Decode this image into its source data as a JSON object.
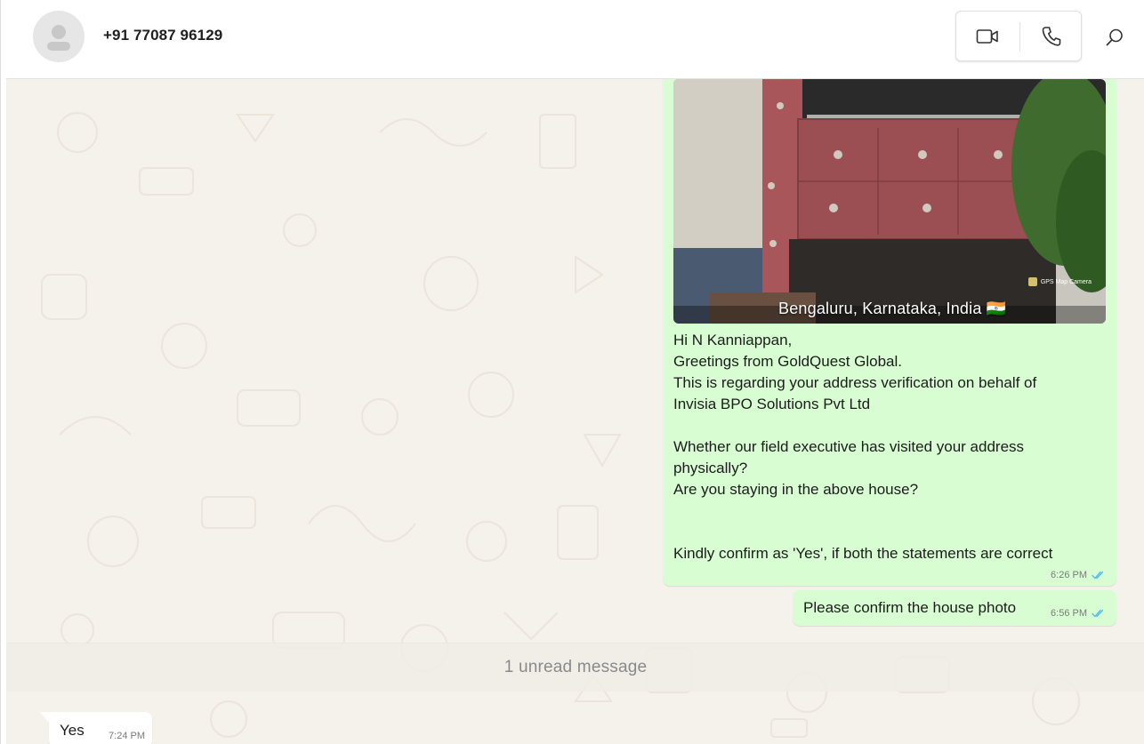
{
  "header": {
    "contact_name": "+91 77087 96129"
  },
  "icons": {
    "avatar": "person-placeholder-icon",
    "video": "video-camera-icon",
    "voice": "phone-icon",
    "search": "search-icon",
    "read": "double-check-icon"
  },
  "colors": {
    "outgoing_bubble": "#d8fdd2",
    "incoming_bubble": "#ffffff",
    "chat_background": "#f5f1eb",
    "read_ticks": "#53bdeb"
  },
  "messages": [
    {
      "direction": "outgoing",
      "photo_caption": "Bengaluru, Karnataka, India 🇮🇳",
      "photo_watermark": "GPS Map Camera",
      "text": "Hi N Kanniappan,\nGreetings from GoldQuest Global.\nThis is regarding your address verification on behalf of\nInvisia BPO Solutions Pvt Ltd\n\nWhether our field executive has visited your address\nphysically?\nAre you staying in the above house?\n\n\nKindly confirm as 'Yes', if both the statements are correct",
      "time": "6:26 PM",
      "status": "read"
    },
    {
      "direction": "outgoing",
      "text": "Please confirm the house photo",
      "time": "6:56 PM",
      "status": "read"
    },
    {
      "direction": "incoming",
      "text": "Yes",
      "time": "7:24 PM"
    }
  ],
  "unread_divider": "1 unread message"
}
